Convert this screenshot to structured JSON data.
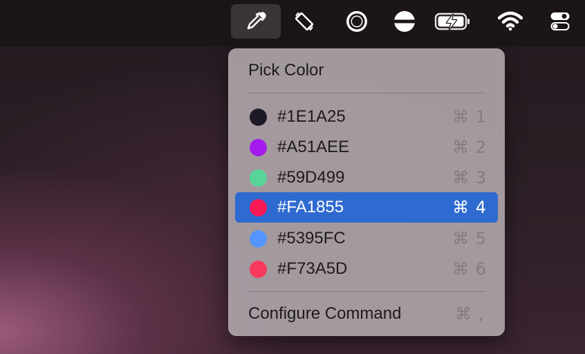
{
  "menubar": {
    "icons": [
      "eyedropper-icon",
      "screen-rotation-icon",
      "record-circle-icon",
      "display-icon",
      "battery-charging-icon",
      "wifi-icon",
      "control-center-icon"
    ]
  },
  "menu": {
    "title": "Pick Color",
    "items": [
      {
        "label": "#1E1A25",
        "color": "#1E1A25",
        "shortcut": "⌘ 1"
      },
      {
        "label": "#A51AEE",
        "color": "#A51AEE",
        "shortcut": "⌘ 2"
      },
      {
        "label": "#59D499",
        "color": "#59D499",
        "shortcut": "⌘ 3"
      },
      {
        "label": "#FA1855",
        "color": "#FA1855",
        "shortcut": "⌘ 4",
        "selected": true
      },
      {
        "label": "#5395FC",
        "color": "#5395FC",
        "shortcut": "⌘ 5"
      },
      {
        "label": "#F73A5D",
        "color": "#F73A5D",
        "shortcut": "⌘ 6"
      }
    ],
    "configure_label": "Configure Command",
    "configure_shortcut": "⌘ ,"
  },
  "colors": {
    "selection": "#2F6AD0",
    "menu_bg": "#ACA2A8",
    "menubar_bg": "#1B1418"
  }
}
